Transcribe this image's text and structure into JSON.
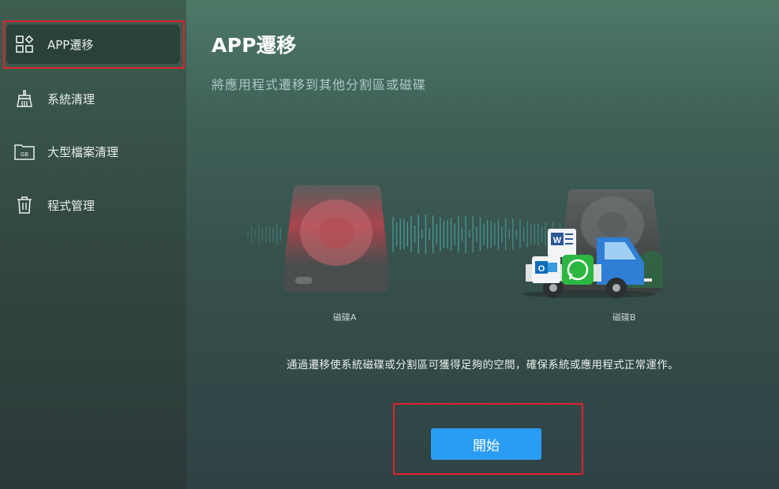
{
  "sidebar": {
    "items": [
      {
        "label": "APP遷移",
        "icon": "app-grid-icon",
        "active": true
      },
      {
        "label": "系統清理",
        "icon": "broom-icon",
        "active": false
      },
      {
        "label": "大型檔案清理",
        "icon": "folder-gb-icon",
        "active": false
      },
      {
        "label": "程式管理",
        "icon": "trash-icon",
        "active": false
      }
    ]
  },
  "main": {
    "title": "APP遷移",
    "subtitle": "將應用程式遷移到其他分割區或磁碟",
    "disk_a_label": "磁碟A",
    "disk_b_label": "磁碟B",
    "description": "通過遷移使系統磁碟或分割區可獲得足夠的空間，確保系統或應用程式正常運作。",
    "start_button": "開始",
    "truck_app_icons": [
      "word-icon",
      "outlook-icon",
      "whatsapp-icon"
    ]
  },
  "colors": {
    "accent_button": "#2a9cf4",
    "highlight_border": "#e0202c",
    "disk_a_tint": "#c0404a",
    "truck_blue": "#2f7fd6"
  }
}
